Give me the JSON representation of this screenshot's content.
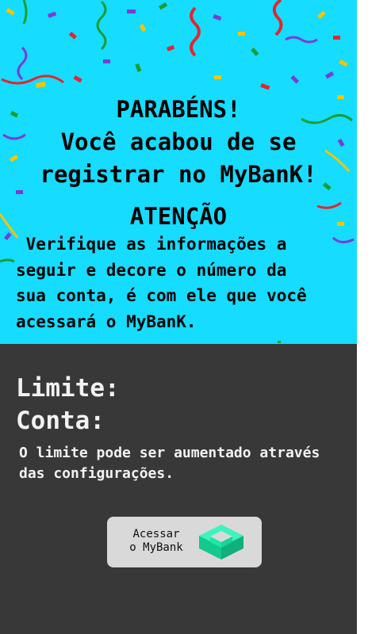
{
  "header": {
    "congrats_line1": "PARABÉNS!",
    "congrats_line2": "Você acabou de se",
    "congrats_line3": "registrar no MyBanK!",
    "attention": "ATENÇÃO",
    "info": " Verifique as informações a\nseguir e decore o número da\nsua conta, é com ele que você\nacessará o MyBanK."
  },
  "account": {
    "limit_label": "Limite:",
    "account_label": "Conta:",
    "note": "O limite pode ser aumentado através das configurações."
  },
  "access_button": {
    "line1": "Acessar",
    "line2": "o MyBank",
    "icon": "mybank-logo-icon"
  },
  "colors": {
    "top_background": "#16dcff",
    "bottom_background": "#383838",
    "button_background": "#d9d9d9",
    "logo_green": "#1de9a6"
  }
}
